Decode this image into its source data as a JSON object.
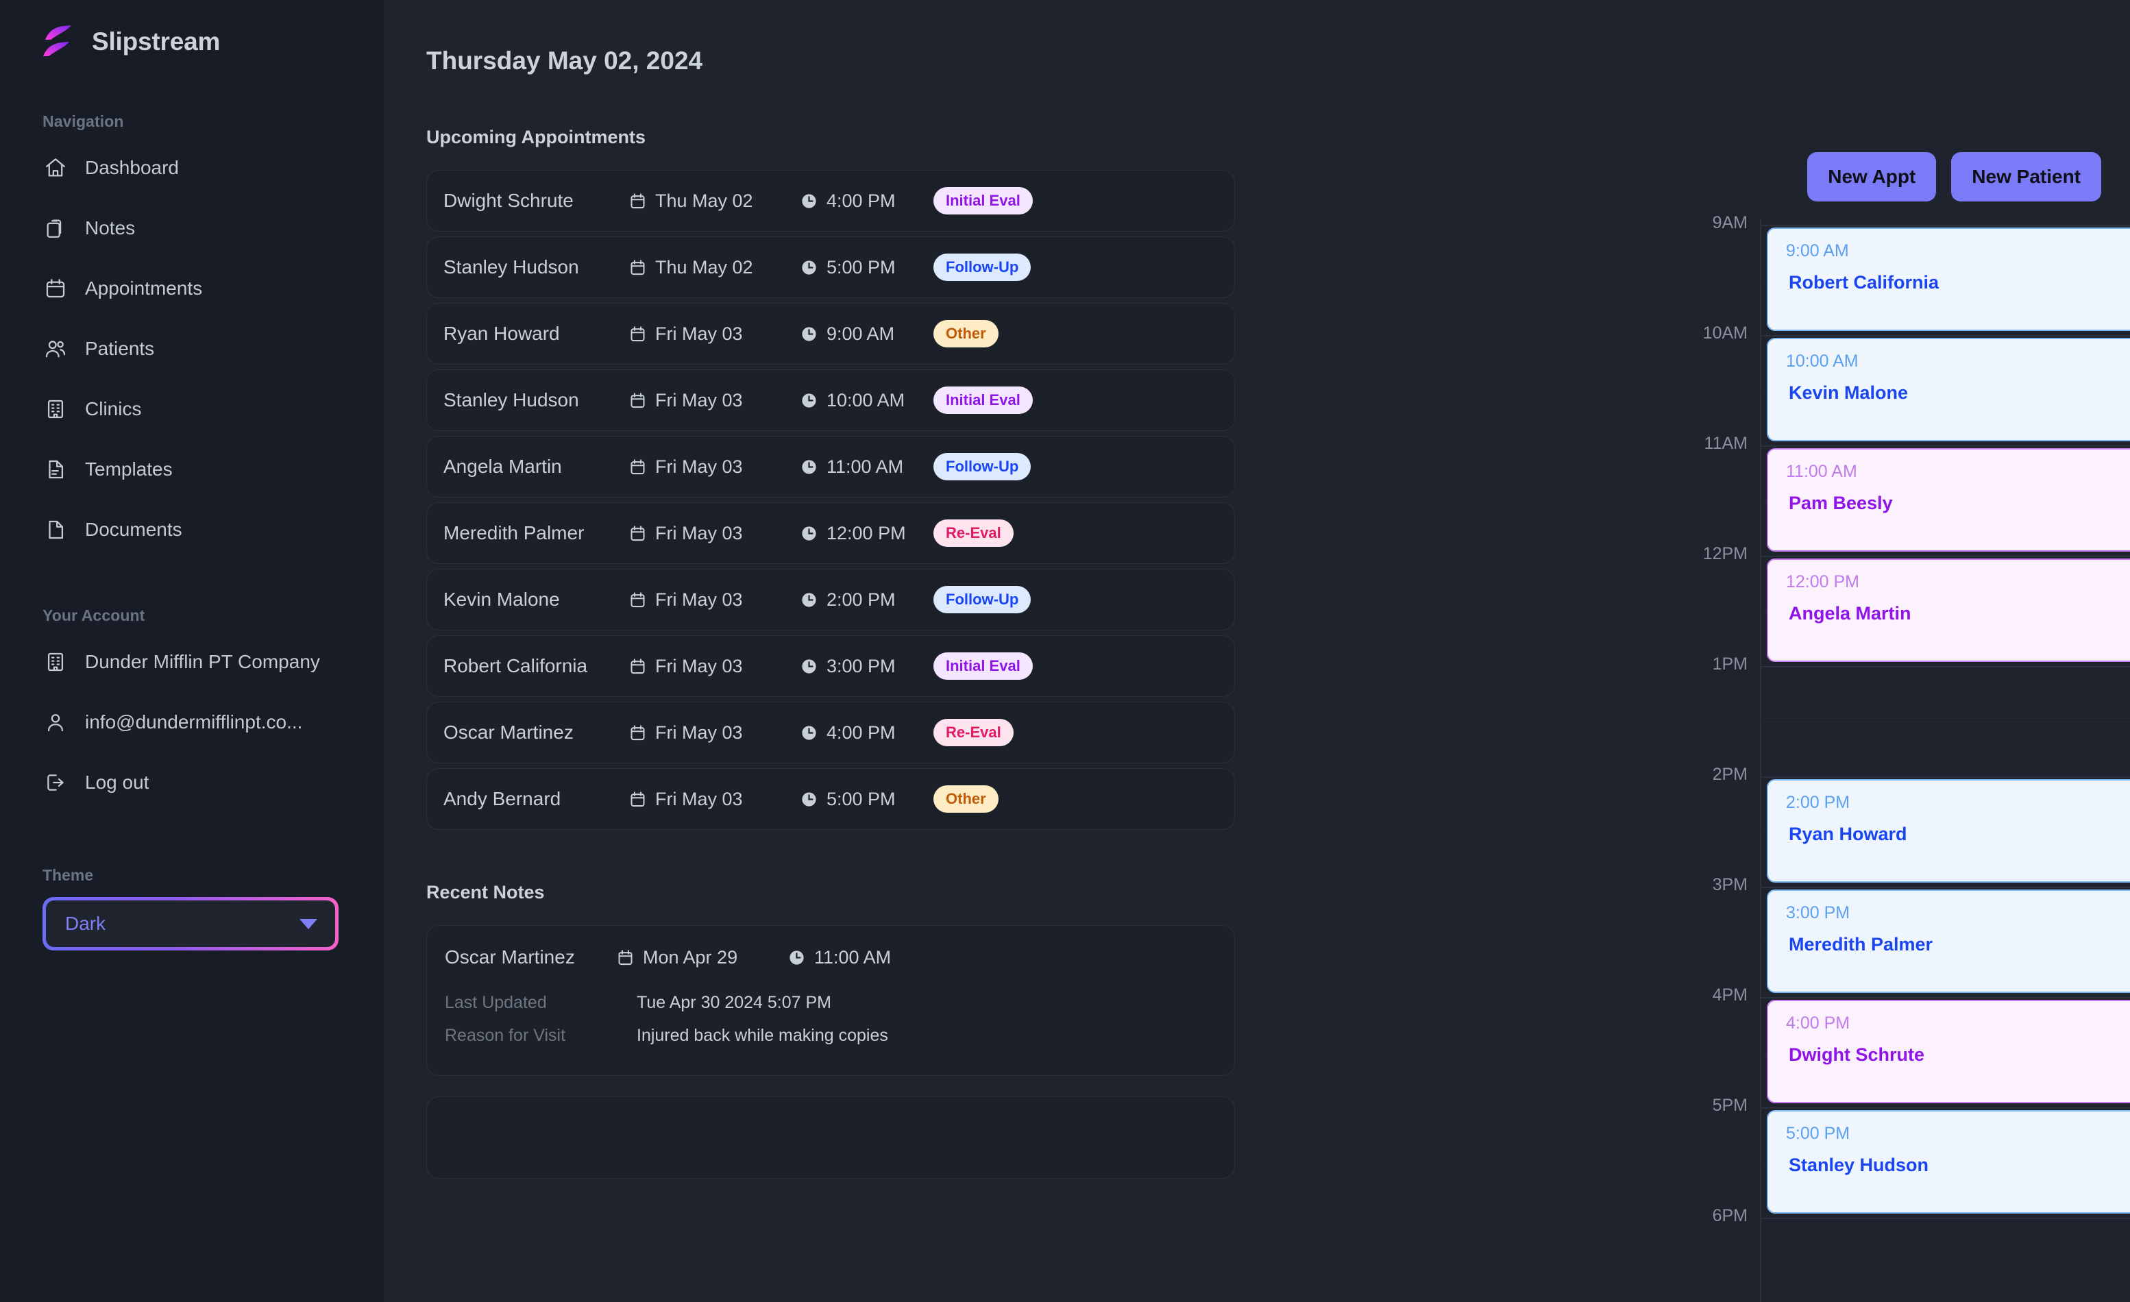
{
  "brand": {
    "name": "Slipstream",
    "logo_icon": "slipstream-wave-logo"
  },
  "sidebar": {
    "nav_label": "Navigation",
    "nav_items": [
      {
        "label": "Dashboard",
        "icon": "home-icon"
      },
      {
        "label": "Notes",
        "icon": "clipboard-icon"
      },
      {
        "label": "Appointments",
        "icon": "calendar-icon"
      },
      {
        "label": "Patients",
        "icon": "users-icon"
      },
      {
        "label": "Clinics",
        "icon": "building-icon"
      },
      {
        "label": "Templates",
        "icon": "file-text-icon"
      },
      {
        "label": "Documents",
        "icon": "file-icon"
      }
    ],
    "account_label": "Your Account",
    "account_items": [
      {
        "label": "Dunder Mifflin PT Company",
        "icon": "building-icon"
      },
      {
        "label": "info@dundermifflinpt.co...",
        "icon": "user-icon"
      },
      {
        "label": "Log out",
        "icon": "logout-icon"
      }
    ],
    "theme_label": "Theme",
    "theme_value": "Dark",
    "theme_caret_icon": "chevron-down-icon",
    "theme_accent_from": "#6c6cf5",
    "theme_accent_to": "#f761c8"
  },
  "header": {
    "date": "Thursday May 02, 2024"
  },
  "toolbar": {
    "new_appt_label": "New Appt",
    "new_patient_label": "New Patient",
    "accent": "#7b7bf7"
  },
  "appointments": {
    "title": "Upcoming Appointments",
    "items": [
      {
        "name": "Dwight Schrute",
        "date": "Thu May 02",
        "time": "4:00 PM",
        "type": "Initial Eval",
        "type_class": "b-initial"
      },
      {
        "name": "Stanley Hudson",
        "date": "Thu May 02",
        "time": "5:00 PM",
        "type": "Follow-Up",
        "type_class": "b-follow"
      },
      {
        "name": "Ryan Howard",
        "date": "Fri May 03",
        "time": "9:00 AM",
        "type": "Other",
        "type_class": "b-other"
      },
      {
        "name": "Stanley Hudson",
        "date": "Fri May 03",
        "time": "10:00 AM",
        "type": "Initial Eval",
        "type_class": "b-initial"
      },
      {
        "name": "Angela Martin",
        "date": "Fri May 03",
        "time": "11:00 AM",
        "type": "Follow-Up",
        "type_class": "b-follow"
      },
      {
        "name": "Meredith Palmer",
        "date": "Fri May 03",
        "time": "12:00 PM",
        "type": "Re-Eval",
        "type_class": "b-re"
      },
      {
        "name": "Kevin Malone",
        "date": "Fri May 03",
        "time": "2:00 PM",
        "type": "Follow-Up",
        "type_class": "b-follow"
      },
      {
        "name": "Robert California",
        "date": "Fri May 03",
        "time": "3:00 PM",
        "type": "Initial Eval",
        "type_class": "b-initial"
      },
      {
        "name": "Oscar Martinez",
        "date": "Fri May 03",
        "time": "4:00 PM",
        "type": "Re-Eval",
        "type_class": "b-re"
      },
      {
        "name": "Andy Bernard",
        "date": "Fri May 03",
        "time": "5:00 PM",
        "type": "Other",
        "type_class": "b-other"
      }
    ]
  },
  "recent_notes": {
    "title": "Recent Notes",
    "items": [
      {
        "name": "Oscar Martinez",
        "date": "Mon Apr 29",
        "time": "11:00 AM",
        "last_updated_label": "Last Updated",
        "last_updated_value": "Tue Apr 30 2024 5:07 PM",
        "reason_label": "Reason for Visit",
        "reason_value": "Injured back while making copies"
      }
    ]
  },
  "schedule": {
    "hours": [
      "9AM",
      "10AM",
      "11AM",
      "12PM",
      "1PM",
      "2PM",
      "3PM",
      "4PM",
      "5PM",
      "6PM"
    ],
    "events": [
      {
        "time": "9:00 AM",
        "name": "Robert California",
        "color": "blue",
        "hour_index": 0
      },
      {
        "time": "10:00 AM",
        "name": "Kevin Malone",
        "color": "blue",
        "hour_index": 1
      },
      {
        "time": "11:00 AM",
        "name": "Pam Beesly",
        "color": "purple",
        "hour_index": 2
      },
      {
        "time": "12:00 PM",
        "name": "Angela Martin",
        "color": "purple",
        "hour_index": 3
      },
      {
        "time": "2:00 PM",
        "name": "Ryan Howard",
        "color": "blue",
        "hour_index": 5
      },
      {
        "time": "3:00 PM",
        "name": "Meredith Palmer",
        "color": "blue",
        "hour_index": 6
      },
      {
        "time": "4:00 PM",
        "name": "Dwight Schrute",
        "color": "purple",
        "hour_index": 7
      },
      {
        "time": "5:00 PM",
        "name": "Stanley Hudson",
        "color": "blue",
        "hour_index": 8
      }
    ]
  }
}
